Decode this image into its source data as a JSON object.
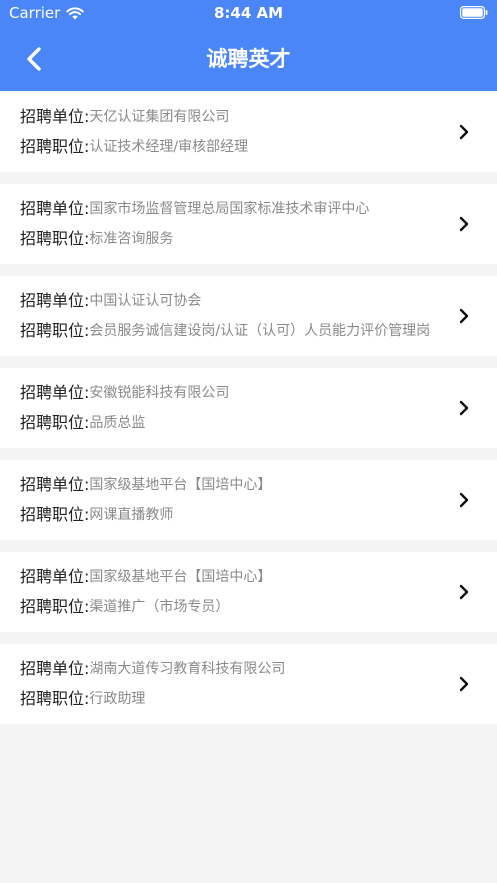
{
  "status_bar": {
    "carrier": "Carrier",
    "time": "8:44 AM"
  },
  "header": {
    "title": "诚聘英才",
    "color": "#4a86f7"
  },
  "field_labels": {
    "company": "招聘单位:",
    "position": "招聘职位:"
  },
  "jobs": [
    {
      "company": "天亿认证集团有限公司",
      "position": "认证技术经理/审核部经理"
    },
    {
      "company": "国家市场监督管理总局国家标准技术审评中心",
      "position": "标准咨询服务"
    },
    {
      "company": "中国认证认可协会",
      "position": "会员服务诚信建设岗/认证（认可）人员能力评价管理岗"
    },
    {
      "company": "安徽锐能科技有限公司",
      "position": "品质总监"
    },
    {
      "company": "国家级基地平台【国培中心】",
      "position": "网课直播教师"
    },
    {
      "company": "国家级基地平台【国培中心】",
      "position": "渠道推广（市场专员）"
    },
    {
      "company": "湖南大道传习教育科技有限公司",
      "position": "行政助理"
    }
  ]
}
